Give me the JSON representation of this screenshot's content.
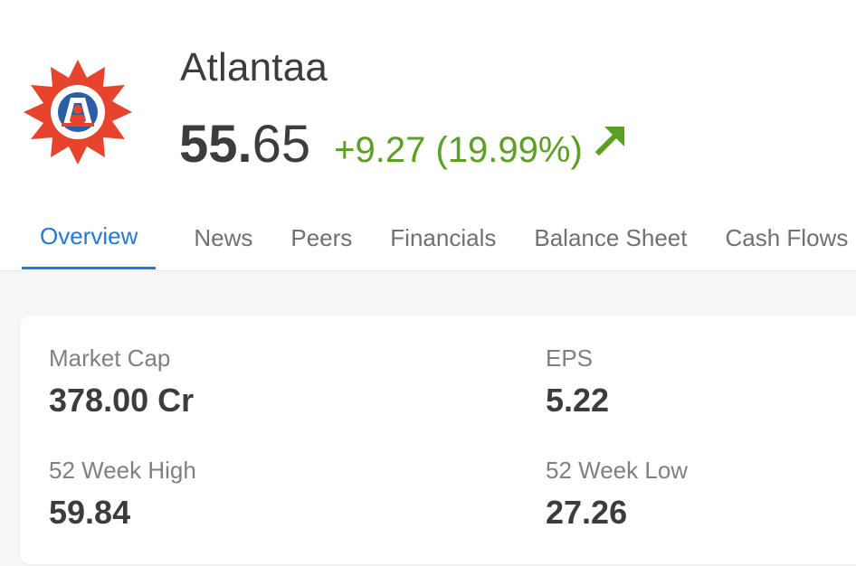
{
  "company": {
    "name": "Atlantaa",
    "logo_colors": {
      "outer": "#e8432c",
      "inner": "#2a5fa8",
      "figure": "#e8432c",
      "center": "#ffffff"
    }
  },
  "quote": {
    "price_int": "55.",
    "price_dec": "65",
    "change": "+9.27 (19.99%)",
    "direction_icon": "arrow-up-right-icon",
    "change_color": "#5aa021"
  },
  "tabs": [
    {
      "label": "Overview",
      "active": true
    },
    {
      "label": "News",
      "active": false
    },
    {
      "label": "Peers",
      "active": false
    },
    {
      "label": "Financials",
      "active": false
    },
    {
      "label": "Balance Sheet",
      "active": false
    },
    {
      "label": "Cash Flows",
      "active": false
    }
  ],
  "stats": {
    "market_cap": {
      "label": "Market Cap",
      "value": "378.00 Cr"
    },
    "eps": {
      "label": "EPS",
      "value": "5.22"
    },
    "week52_high": {
      "label": "52 Week High",
      "value": "59.84"
    },
    "week52_low": {
      "label": "52 Week Low",
      "value": "27.26"
    }
  },
  "colors": {
    "accent": "#1f7ae0",
    "text": "#3c3c3c",
    "muted": "#808080",
    "positive": "#5aa021"
  }
}
